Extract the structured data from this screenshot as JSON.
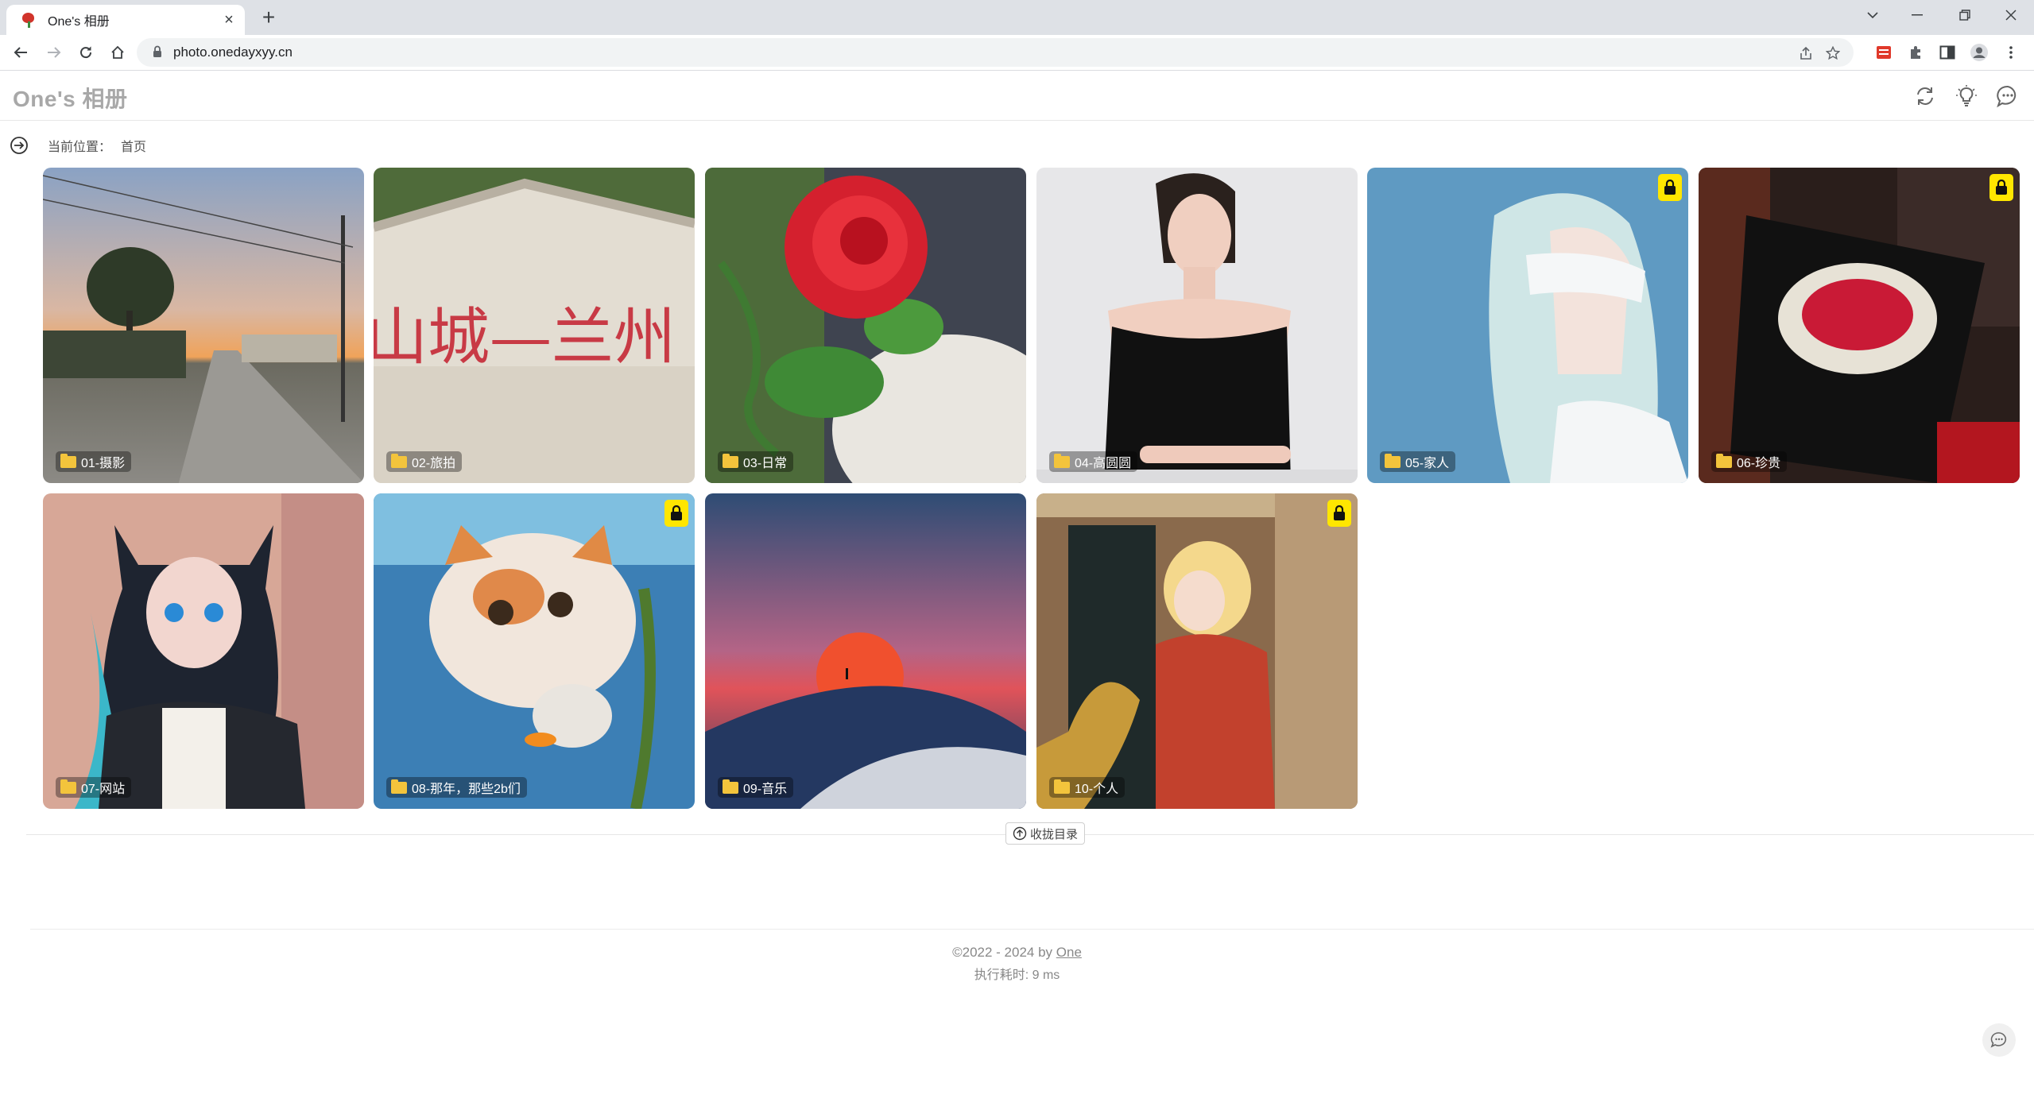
{
  "browser": {
    "tab_title": "One's 相册",
    "new_tab": "+",
    "tab_close": "×",
    "url": "photo.onedayxyy.cn"
  },
  "site": {
    "brand": "One's 相册"
  },
  "breadcrumb": {
    "label": "当前位置：",
    "home": "首页"
  },
  "albums": [
    {
      "label": "01-摄影",
      "locked": false
    },
    {
      "label": "02-旅拍",
      "locked": false
    },
    {
      "label": "03-日常",
      "locked": false
    },
    {
      "label": "04-高圆圆",
      "locked": false
    },
    {
      "label": "05-家人",
      "locked": true
    },
    {
      "label": "06-珍贵",
      "locked": true
    },
    {
      "label": "07-网站",
      "locked": false
    },
    {
      "label": "08-那年，那些2b们",
      "locked": true
    },
    {
      "label": "09-音乐",
      "locked": false
    },
    {
      "label": "10-个人",
      "locked": true
    }
  ],
  "photo_text": {
    "card2": "山城—兰州"
  },
  "footer": {
    "collapse_label": "收拢目录",
    "copyright_prefix": "©2022 - 2024 by ",
    "author": "One",
    "exec_time": "执行耗时: 9 ms"
  },
  "colors": {
    "lock_badge": "#ffe600",
    "folder_icon": "#f3c43c",
    "brand_text": "#a8a8a8"
  }
}
